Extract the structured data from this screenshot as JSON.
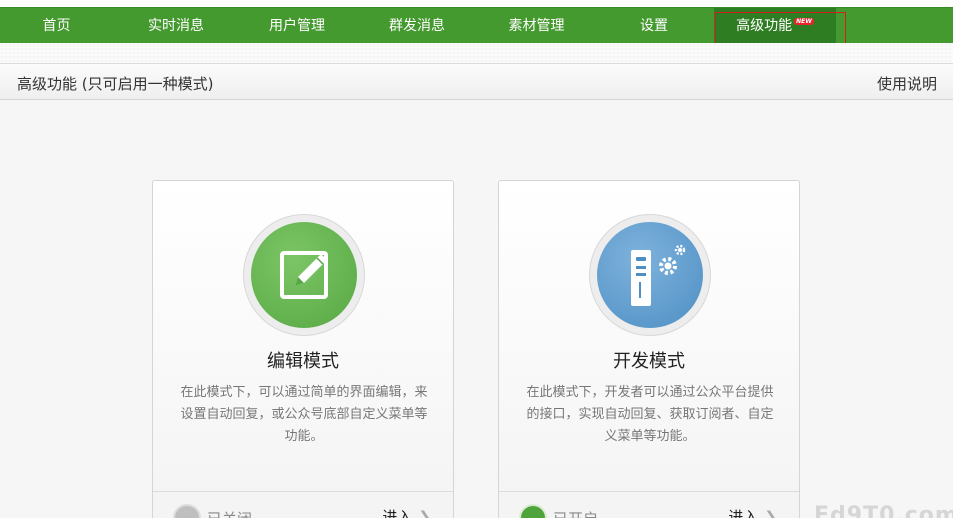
{
  "nav": {
    "items": [
      {
        "label": "首页"
      },
      {
        "label": "实时消息"
      },
      {
        "label": "用户管理"
      },
      {
        "label": "群发消息"
      },
      {
        "label": "素材管理"
      },
      {
        "label": "设置"
      },
      {
        "label": "高级功能",
        "badge": "NEW",
        "active": true
      }
    ]
  },
  "header": {
    "title": "高级功能 (只可启用一种模式)",
    "help": "使用说明"
  },
  "cards": [
    {
      "title": "编辑模式",
      "icon": "edit-pencil-icon",
      "desc": "在此模式下，可以通过简单的界面编辑，来设置自动回复，或公众号底部自定义菜单等功能。",
      "status": "已关闭",
      "enter": "进入"
    },
    {
      "title": "开发模式",
      "icon": "server-gear-icon",
      "desc": "在此模式下，开发者可以通过公众平台提供的接口，实现自动回复、获取订阅者、自定义菜单等功能。",
      "status": "已开启",
      "enter": "进入"
    }
  ],
  "watermark": "Fd9T0.com",
  "colors": {
    "nav_bg": "#44992f",
    "nav_active": "#2f7d22",
    "edit_accent": "#5cb04a",
    "dev_accent": "#5a9bd0",
    "status_on": "#4fa33b"
  }
}
